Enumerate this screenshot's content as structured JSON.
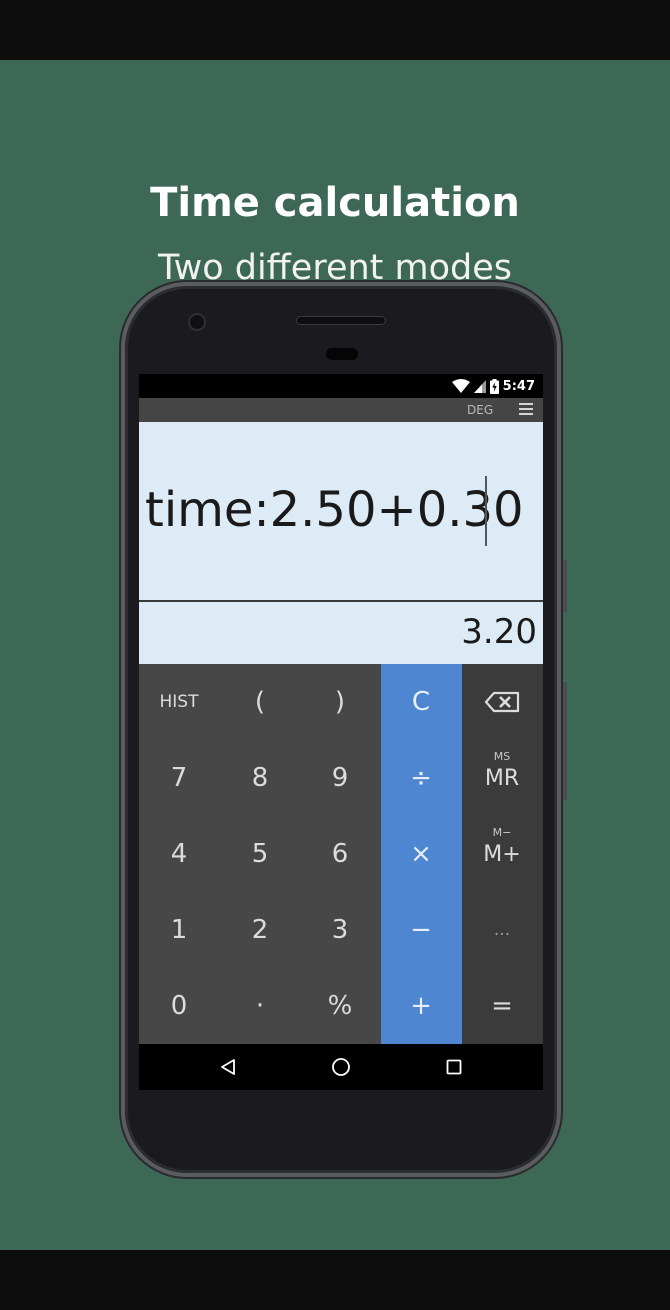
{
  "promo": {
    "title": "Time calculation",
    "subtitle": "Two different modes",
    "background_color": "#3d6856"
  },
  "status_bar": {
    "time": "5:47",
    "icons": [
      "wifi-icon",
      "cell-signal-icon",
      "battery-charging-icon"
    ]
  },
  "app_bar": {
    "angle_mode": "DEG",
    "menu_icon": "menu-icon"
  },
  "display": {
    "expression": "time:2.50+0.30",
    "result": "3.20"
  },
  "keypad": {
    "rows": [
      [
        "HIST",
        "(",
        ")",
        "C",
        "backspace"
      ],
      [
        "7",
        "8",
        "9",
        "÷",
        "MR"
      ],
      [
        "4",
        "5",
        "6",
        "×",
        "M+"
      ],
      [
        "1",
        "2",
        "3",
        "−",
        "..."
      ],
      [
        "0",
        "·",
        "%",
        "+",
        "="
      ]
    ],
    "hist": "HIST",
    "lparen": "(",
    "rparen": ")",
    "clear": "C",
    "seven": "7",
    "eight": "8",
    "nine": "9",
    "divide": "÷",
    "mr": "MR",
    "ms": "MS",
    "four": "4",
    "five": "5",
    "six": "6",
    "multiply": "×",
    "mplus": "M+",
    "mminus": "M−",
    "one": "1",
    "two": "2",
    "three": "3",
    "minus": "−",
    "more": "...",
    "zero": "0",
    "dot": "·",
    "percent": "%",
    "plus": "+",
    "equals": "=",
    "operator_color": "#4e86d1"
  },
  "nav_bar": {
    "buttons": [
      "back-icon",
      "home-icon",
      "recents-icon"
    ]
  }
}
